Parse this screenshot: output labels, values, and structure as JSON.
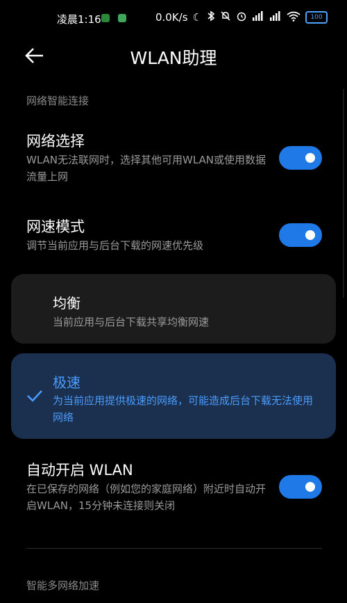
{
  "status_bar": {
    "time": "凌晨1:16",
    "speed": "0.0K/s",
    "battery": "100"
  },
  "header": {
    "title": "WLAN助理"
  },
  "sections": {
    "smart_connect_label": "网络智能连接",
    "multi_network_label": "智能多网络加速"
  },
  "settings": {
    "network_selection": {
      "title": "网络选择",
      "desc": "WLAN无法联网时，选择其他可用WLAN或使用数据流量上网",
      "enabled": true
    },
    "speed_mode": {
      "title": "网速模式",
      "desc": "调节当前应用与后台下载的网速优先级",
      "enabled": true
    },
    "auto_wlan": {
      "title": "自动开启 WLAN",
      "desc": "在已保存的网络（例如您的家庭网络）附近时自动开启WLAN，15分钟未连接则关闭",
      "enabled": true
    }
  },
  "speed_options": {
    "balanced": {
      "title": "均衡",
      "desc": "当前应用与后台下载共享均衡网速",
      "selected": false
    },
    "fast": {
      "title": "极速",
      "desc": "为当前应用提供极速的网络，可能造成后台下载无法使用网络",
      "selected": true
    }
  },
  "colors": {
    "background": "#000000",
    "accent": "#1f7ae8",
    "selected_card": "#1b2f4e",
    "selected_text": "#4a9cff",
    "card": "#1c1c1c"
  }
}
